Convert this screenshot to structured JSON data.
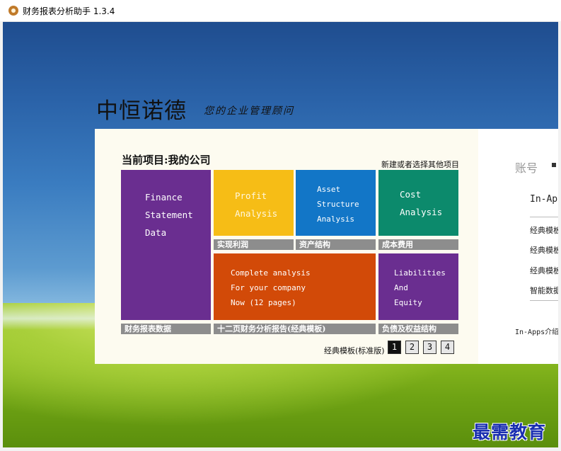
{
  "window": {
    "title": "财务报表分析助手 1.3.4"
  },
  "brand": {
    "name": "中恒诺德",
    "slogan": "您的企业管理顾问"
  },
  "project": {
    "title": "当前项目:我的公司",
    "new_link": "新建或者选择其他项目"
  },
  "tiles": {
    "finance": {
      "lines": [
        "Finance",
        "Statement",
        "Data"
      ],
      "caption": "财务报表数据",
      "color": "#6a2e90"
    },
    "profit": {
      "lines": [
        "Profit",
        "Analysis"
      ],
      "caption": "实现利润",
      "color": "#f6bd16"
    },
    "asset": {
      "lines": [
        "Asset",
        "Structure",
        "Analysis"
      ],
      "caption": "资产结构",
      "color": "#1276c7"
    },
    "cost": {
      "lines": [
        "Cost",
        "Analysis"
      ],
      "caption": "成本费用",
      "color": "#0c8a6c"
    },
    "complete": {
      "lines": [
        "Complete analysis",
        "For your company",
        "Now (12 pages)"
      ],
      "caption": "十二页财务分析报告(经典模板)",
      "color": "#d24a08"
    },
    "liabilities": {
      "lines": [
        "Liabilities",
        "And",
        "Equity"
      ],
      "caption": "负债及权益结构",
      "color": "#6a2e90"
    }
  },
  "pager": {
    "label": "经典模板(标准版)",
    "pages": [
      "1",
      "2",
      "3",
      "4"
    ],
    "active": "1"
  },
  "side": {
    "account_label": "账号",
    "inapp_head": "In-App",
    "items": [
      "经典模板",
      "经典模板",
      "经典模板",
      "智能数据"
    ],
    "inapp_intro": "In-Apps介绍"
  },
  "watermark": "最需教育"
}
